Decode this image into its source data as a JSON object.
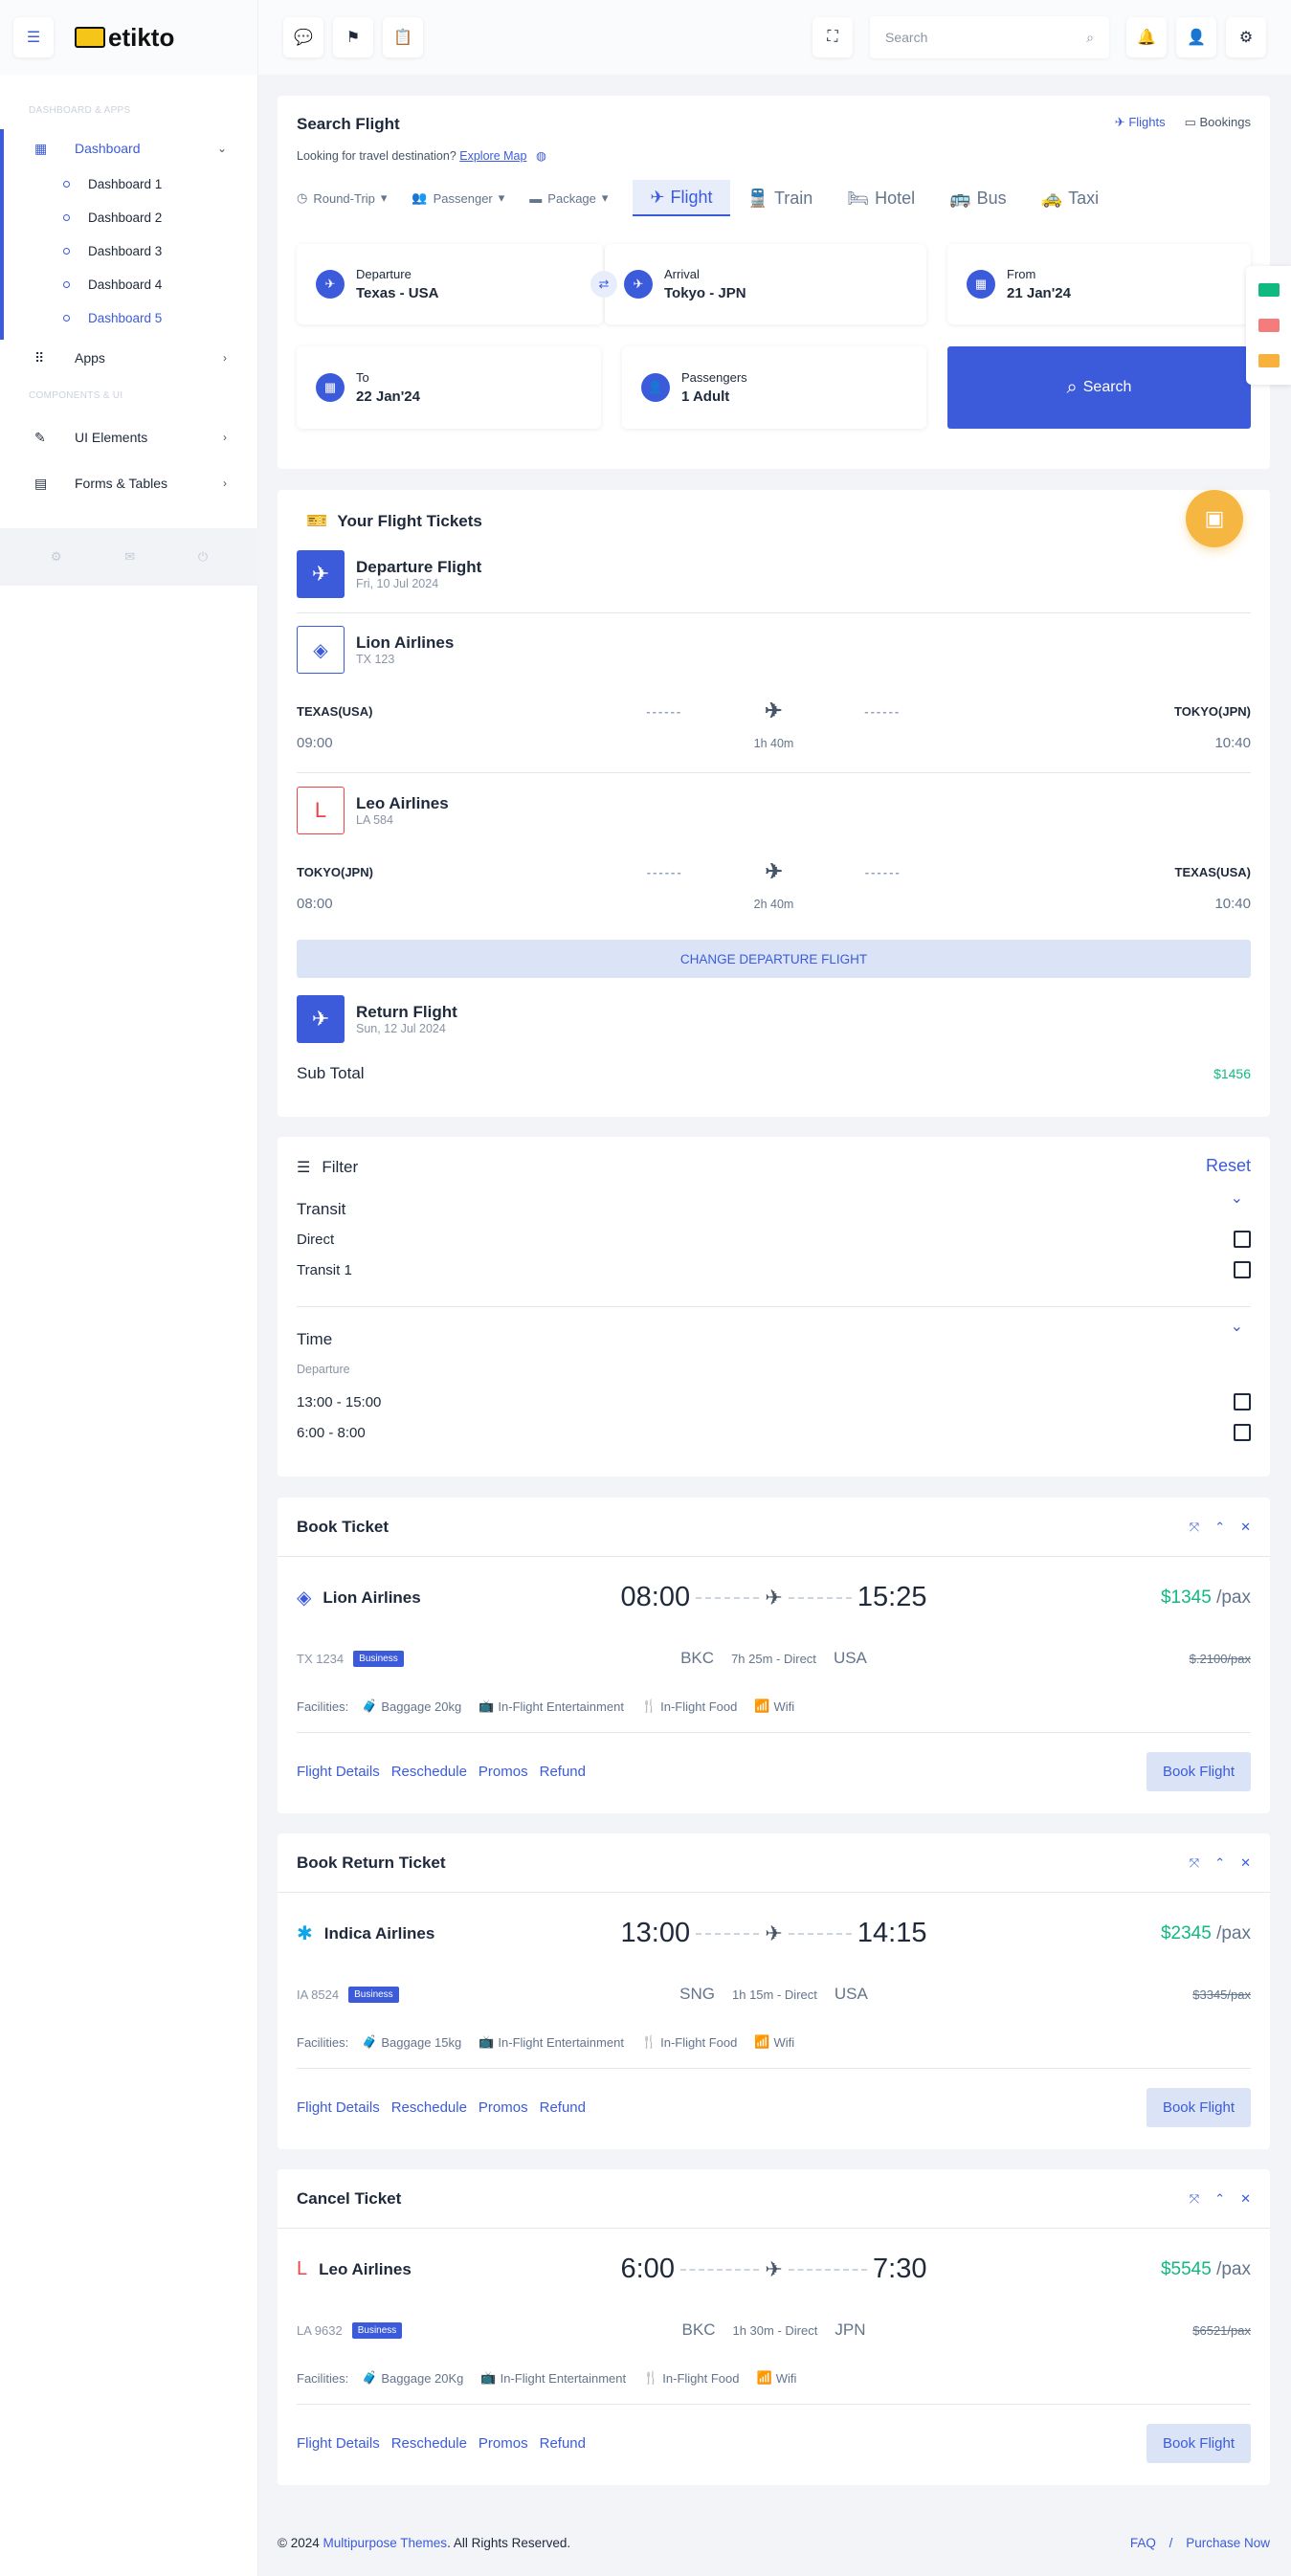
{
  "sidebar": {
    "logo": "etikto",
    "section1": "DASHBOARD & APPS",
    "dashboard_label": "Dashboard",
    "dashboards": [
      "Dashboard 1",
      "Dashboard 2",
      "Dashboard 3",
      "Dashboard 4",
      "Dashboard 5"
    ],
    "apps_label": "Apps",
    "section2": "COMPONENTS & UI",
    "ui_elements": "UI Elements",
    "forms_tables": "Forms & Tables"
  },
  "topbar": {
    "search_placeholder": "Search"
  },
  "search_flight": {
    "title": "Search Flight",
    "subtitle": "Looking for travel destination?",
    "explore_link": "Explore Map",
    "flights_tab": "Flights",
    "bookings_tab": "Bookings",
    "options": [
      "Round-Trip",
      "Passenger",
      "Package"
    ],
    "modes": [
      "Flight",
      "Train",
      "Hotel",
      "Bus",
      "Taxi"
    ],
    "departure_label": "Departure",
    "departure_value": "Texas - USA",
    "arrival_label": "Arrival",
    "arrival_value": "Tokyo - JPN",
    "from_label": "From",
    "from_value": "21 Jan'24",
    "to_label": "To",
    "to_value": "22 Jan'24",
    "passengers_label": "Passengers",
    "passengers_value": "1 Adult",
    "search_button": "Search"
  },
  "tickets": {
    "title": "Your Flight Tickets",
    "departure_title": "Departure Flight",
    "departure_date": "Fri, 10 Jul 2024",
    "flights": [
      {
        "airline": "Lion Airlines",
        "code": "TX 123",
        "from": "TEXAS(USA)",
        "to": "TOKYO(JPN)",
        "dep": "09:00",
        "arr": "10:40",
        "duration": "1h 40m"
      },
      {
        "airline": "Leo Airlines",
        "code": "LA 584",
        "from": "TOKYO(JPN)",
        "to": "TEXAS(USA)",
        "dep": "08:00",
        "arr": "10:40",
        "duration": "2h 40m"
      }
    ],
    "change_button": "CHANGE DEPARTURE FLIGHT",
    "return_title": "Return Flight",
    "return_date": "Sun, 12 Jul 2024",
    "subtotal_label": "Sub Total",
    "subtotal_value": "$1456"
  },
  "filter": {
    "title": "Filter",
    "reset": "Reset",
    "transit_title": "Transit",
    "transit_options": [
      "Direct",
      "Transit 1"
    ],
    "time_title": "Time",
    "time_sub": "Departure",
    "time_options": [
      "13:00 - 15:00",
      "6:00 - 8:00"
    ]
  },
  "book_cards": [
    {
      "title": "Book Ticket",
      "airline": "Lion Airlines",
      "dep": "08:00",
      "arr": "15:25",
      "price": "$1345",
      "per": "/pax",
      "code": "TX 1234",
      "class": "Business",
      "from": "BKC",
      "to": "USA",
      "info": "7h 25m - Direct",
      "old_price": "$.2100/pax",
      "baggage": "Baggage 20kg"
    },
    {
      "title": "Book Return Ticket",
      "airline": "Indica Airlines",
      "dep": "13:00",
      "arr": "14:15",
      "price": "$2345",
      "per": "/pax",
      "code": "IA 8524",
      "class": "Business",
      "from": "SNG",
      "to": "USA",
      "info": "1h 15m - Direct",
      "old_price": "$3345/pax",
      "baggage": "Baggage 15kg"
    },
    {
      "title": "Cancel Ticket",
      "airline": "Leo Airlines",
      "dep": "6:00",
      "arr": "7:30",
      "price": "$5545",
      "per": "/pax",
      "code": "LA 9632",
      "class": "Business",
      "from": "BKC",
      "to": "JPN",
      "info": "1h 30m - Direct",
      "old_price": "$6521/pax",
      "baggage": "Baggage 20Kg"
    }
  ],
  "facilities": {
    "label": "Facilities:",
    "entertainment": "In-Flight Entertainment",
    "food": "In-Flight Food",
    "wifi": "Wifi"
  },
  "card_links": [
    "Flight Details",
    "Reschedule",
    "Promos",
    "Refund"
  ],
  "book_button": "Book Flight",
  "footer": {
    "copy": "© 2024",
    "brand": "Multipurpose Themes",
    "rights": ". All Rights Reserved.",
    "faq": "FAQ",
    "purchase": "Purchase Now"
  }
}
